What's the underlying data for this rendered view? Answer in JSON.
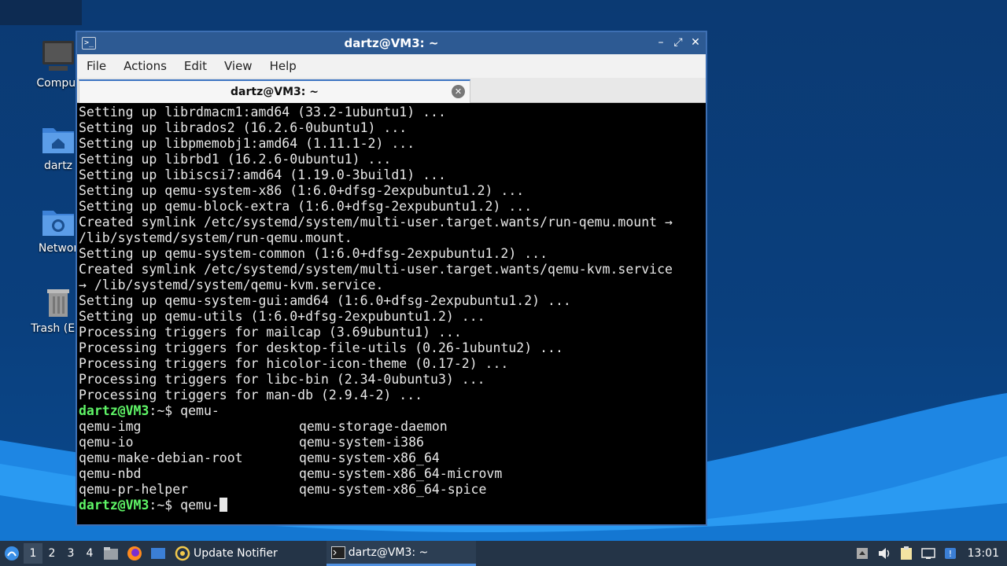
{
  "desktop": {
    "icons": [
      {
        "label": "Comput",
        "icon": "computer-icon"
      },
      {
        "label": "dartz",
        "icon": "home-folder-icon"
      },
      {
        "label": "Networ",
        "icon": "network-folder-icon"
      },
      {
        "label": "Trash (Em",
        "icon": "trash-icon"
      }
    ]
  },
  "window": {
    "title": "dartz@VM3: ~",
    "controls": {
      "minimize": "–",
      "maximize": "⤢",
      "close": "✕"
    },
    "menu": [
      "File",
      "Actions",
      "Edit",
      "View",
      "Help"
    ],
    "tab": {
      "title": "dartz@VM3: ~",
      "close": "✕"
    }
  },
  "terminal": {
    "output": [
      "Setting up librdmacm1:amd64 (33.2-1ubuntu1) ...",
      "Setting up librados2 (16.2.6-0ubuntu1) ...",
      "Setting up libpmemobj1:amd64 (1.11.1-2) ...",
      "Setting up librbd1 (16.2.6-0ubuntu1) ...",
      "Setting up libiscsi7:amd64 (1.19.0-3build1) ...",
      "Setting up qemu-system-x86 (1:6.0+dfsg-2expubuntu1.2) ...",
      "Setting up qemu-block-extra (1:6.0+dfsg-2expubuntu1.2) ...",
      "Created symlink /etc/systemd/system/multi-user.target.wants/run-qemu.mount →",
      "/lib/systemd/system/run-qemu.mount.",
      "Setting up qemu-system-common (1:6.0+dfsg-2expubuntu1.2) ...",
      "Created symlink /etc/systemd/system/multi-user.target.wants/qemu-kvm.service",
      "→ /lib/systemd/system/qemu-kvm.service.",
      "Setting up qemu-system-gui:amd64 (1:6.0+dfsg-2expubuntu1.2) ...",
      "Setting up qemu-utils (1:6.0+dfsg-2expubuntu1.2) ...",
      "Processing triggers for mailcap (3.69ubuntu1) ...",
      "Processing triggers for desktop-file-utils (0.26-1ubuntu2) ...",
      "Processing triggers for hicolor-icon-theme (0.17-2) ...",
      "Processing triggers for libc-bin (2.34-0ubuntu3) ...",
      "Processing triggers for man-db (2.9.4-2) ..."
    ],
    "prompt": "dartz@VM3",
    "prompt_suffix": ":~$ ",
    "command1": "qemu-",
    "completions": [
      [
        "qemu-img",
        "qemu-storage-daemon"
      ],
      [
        "qemu-io",
        "qemu-system-i386"
      ],
      [
        "qemu-make-debian-root",
        "qemu-system-x86_64"
      ],
      [
        "qemu-nbd",
        "qemu-system-x86_64-microvm"
      ],
      [
        "qemu-pr-helper",
        "qemu-system-x86_64-spice"
      ]
    ],
    "command2": "qemu-"
  },
  "taskbar": {
    "workspaces": [
      "1",
      "2",
      "3",
      "4"
    ],
    "active_workspace": "1",
    "tasks": [
      {
        "label": "Update Notifier",
        "icon": "update-notifier-icon"
      },
      {
        "label": "dartz@VM3: ~",
        "icon": "terminal-icon"
      }
    ],
    "clock": "13:01"
  },
  "colors": {
    "prompt": "#5ff567",
    "titlebar": "#2d5a93",
    "accent": "#4f90e0"
  }
}
